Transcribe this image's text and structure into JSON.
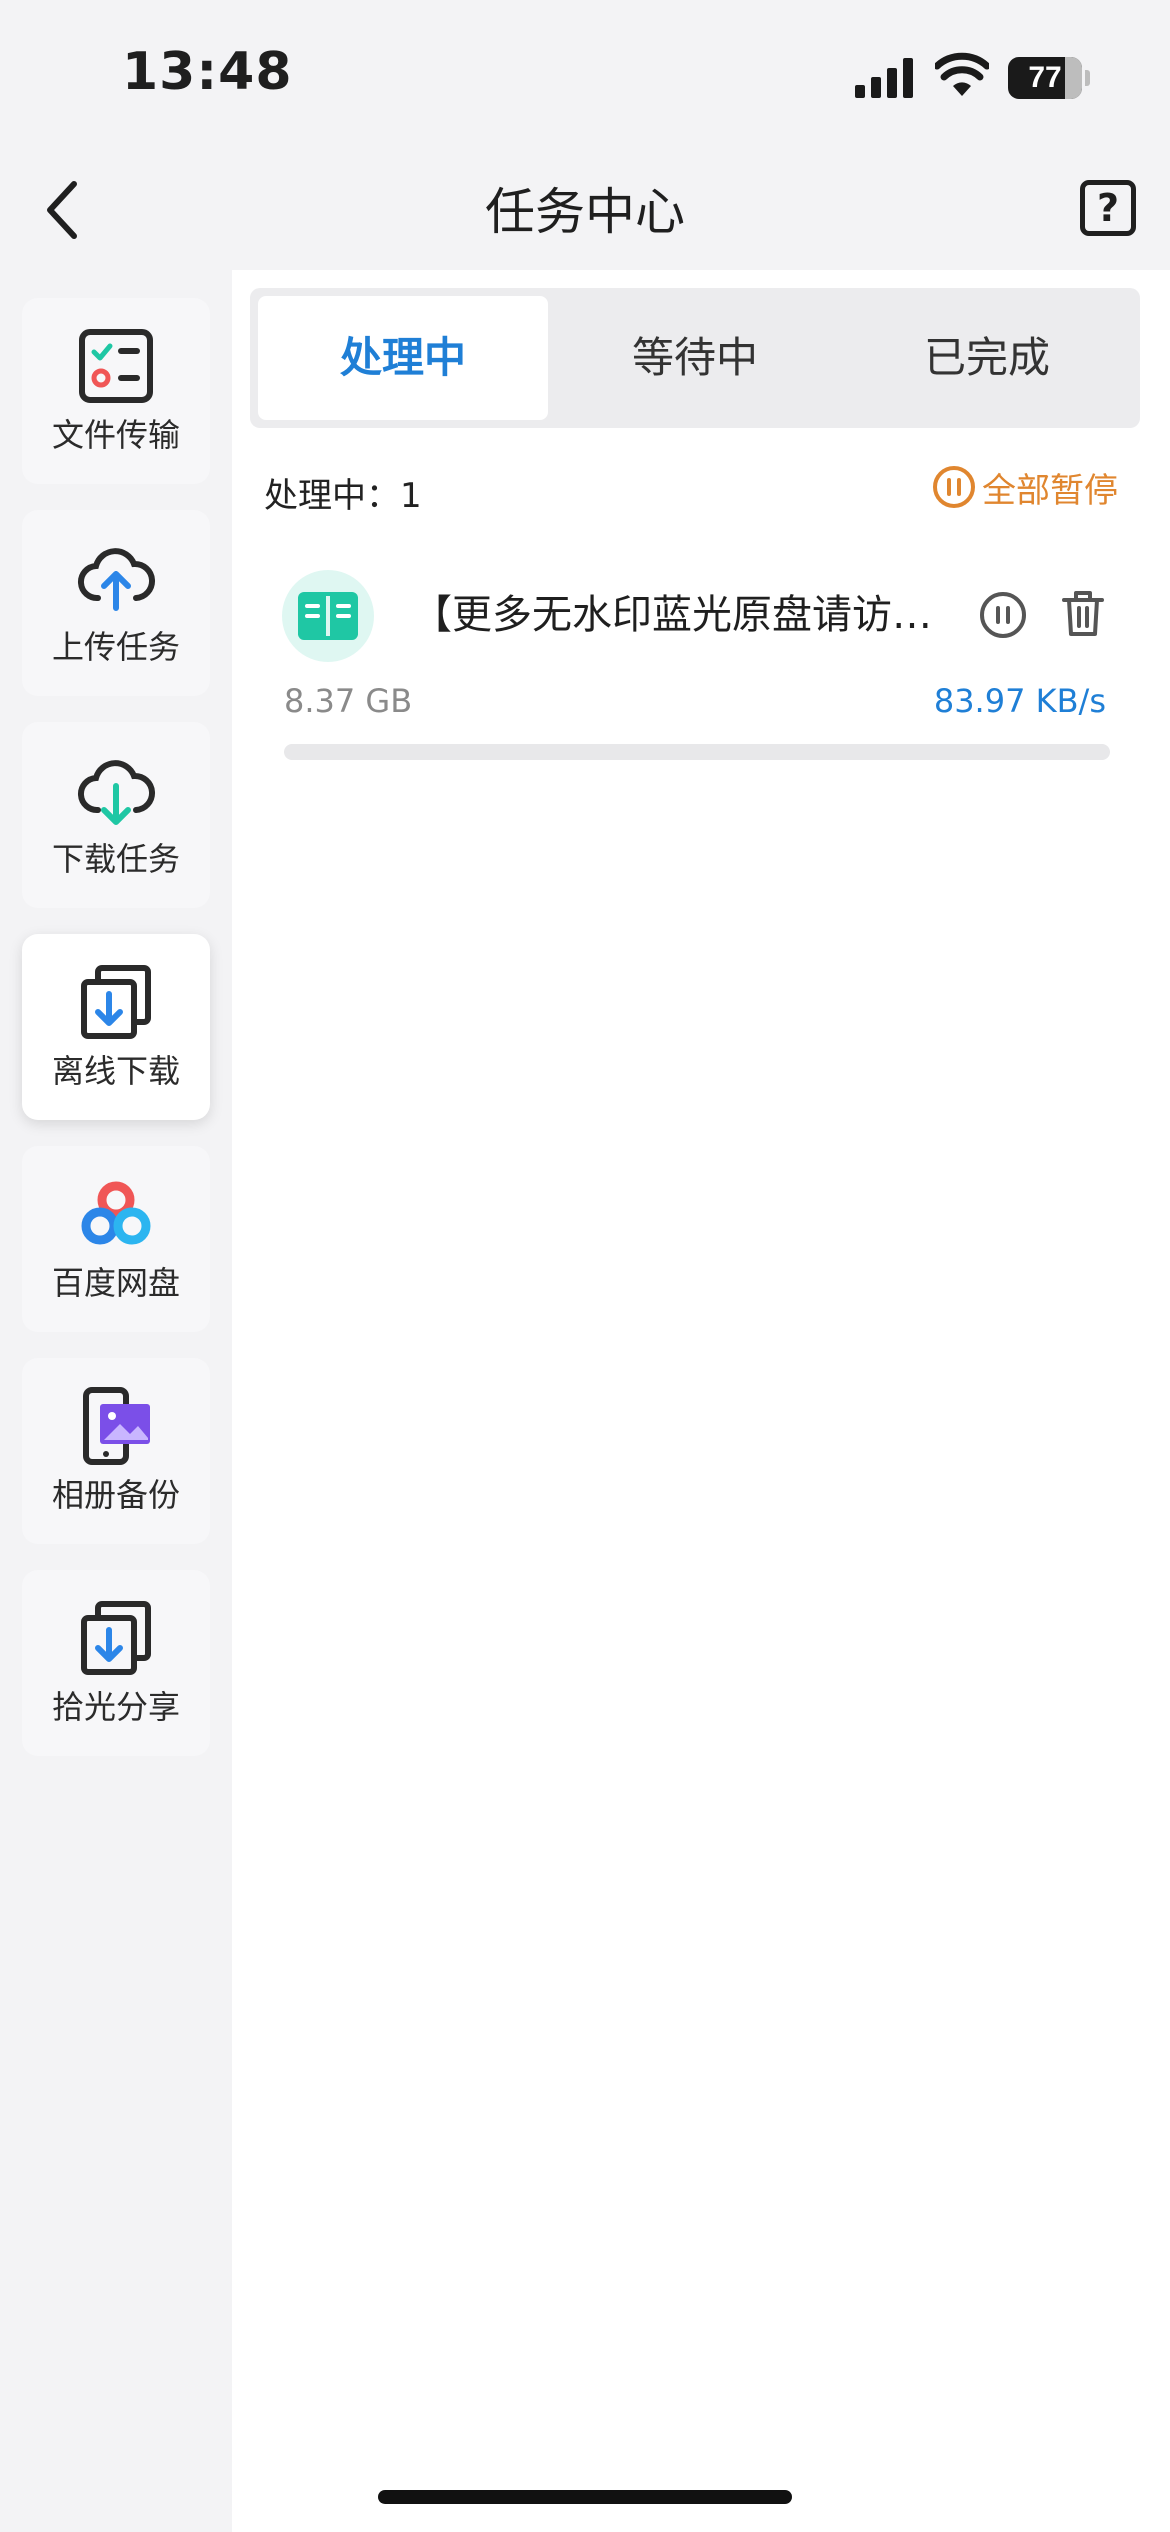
{
  "status_bar": {
    "time": "13:48",
    "battery_level": "77",
    "battery_fraction": 0.77
  },
  "nav": {
    "title": "任务中心",
    "help_symbol": "?",
    "back_icon": "chevron-left-icon",
    "help_icon": "help-icon"
  },
  "sidebar": {
    "items": [
      {
        "label": "文件传输",
        "icon": "file-transfer-icon",
        "active": false
      },
      {
        "label": "上传任务",
        "icon": "cloud-upload-icon",
        "active": false
      },
      {
        "label": "下载任务",
        "icon": "cloud-download-icon",
        "active": false
      },
      {
        "label": "离线下载",
        "icon": "offline-download-icon",
        "active": true
      },
      {
        "label": "百度网盘",
        "icon": "baidu-netdisk-icon",
        "active": false
      },
      {
        "label": "相册备份",
        "icon": "album-backup-icon",
        "active": false
      },
      {
        "label": "拾光分享",
        "icon": "share-download-icon",
        "active": false
      }
    ]
  },
  "tabs": [
    {
      "label": "处理中",
      "active": true
    },
    {
      "label": "等待中",
      "active": false
    },
    {
      "label": "已完成",
      "active": false
    }
  ],
  "summary": {
    "count_label": "处理中：1",
    "pause_all_label": "全部暂停"
  },
  "tasks": [
    {
      "name": "【更多无水印蓝光原盘请访…",
      "size": "8.37 GB",
      "speed": "83.97 KB/s",
      "progress": 0,
      "icon": "book-icon"
    }
  ],
  "colors": {
    "accent_blue": "#1f7fd6",
    "accent_orange": "#e0862f",
    "teal": "#1fc7a4"
  }
}
